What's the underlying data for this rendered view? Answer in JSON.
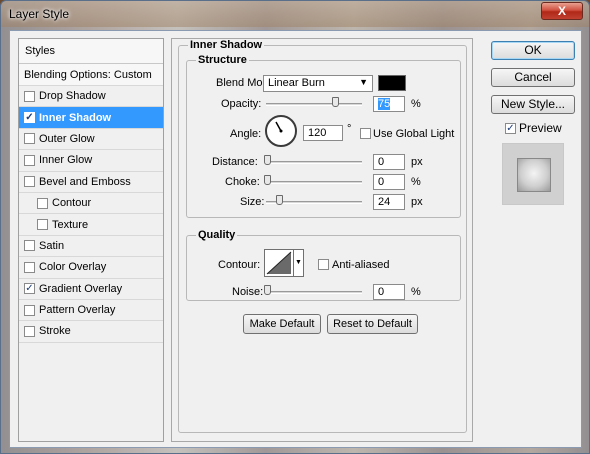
{
  "window": {
    "title": "Layer Style",
    "close_glyph": "X"
  },
  "styles": {
    "header": "Styles",
    "blending": "Blending Options: Custom",
    "items": [
      {
        "label": "Drop Shadow",
        "checked": false,
        "indent": false,
        "selected": false
      },
      {
        "label": "Inner Shadow",
        "checked": true,
        "indent": false,
        "selected": true
      },
      {
        "label": "Outer Glow",
        "checked": false,
        "indent": false,
        "selected": false
      },
      {
        "label": "Inner Glow",
        "checked": false,
        "indent": false,
        "selected": false
      },
      {
        "label": "Bevel and Emboss",
        "checked": false,
        "indent": false,
        "selected": false
      },
      {
        "label": "Contour",
        "checked": false,
        "indent": true,
        "selected": false
      },
      {
        "label": "Texture",
        "checked": false,
        "indent": true,
        "selected": false
      },
      {
        "label": "Satin",
        "checked": false,
        "indent": false,
        "selected": false
      },
      {
        "label": "Color Overlay",
        "checked": false,
        "indent": false,
        "selected": false
      },
      {
        "label": "Gradient Overlay",
        "checked": true,
        "indent": false,
        "selected": false
      },
      {
        "label": "Pattern Overlay",
        "checked": false,
        "indent": false,
        "selected": false
      },
      {
        "label": "Stroke",
        "checked": false,
        "indent": false,
        "selected": false
      }
    ]
  },
  "panel": {
    "title": "Inner Shadow",
    "structure": {
      "label": "Structure",
      "blend_mode_label": "Blend Mode:",
      "blend_mode": "Linear Burn",
      "blend_color": "#000000",
      "opacity_label": "Opacity:",
      "opacity": "75",
      "opacity_unit": "%",
      "angle_label": "Angle:",
      "angle": "120",
      "angle_unit": "°",
      "global_light_label": "Use Global Light",
      "distance_label": "Distance:",
      "distance": "0",
      "distance_unit": "px",
      "choke_label": "Choke:",
      "choke": "0",
      "choke_unit": "%",
      "size_label": "Size:",
      "size": "24",
      "size_unit": "px"
    },
    "quality": {
      "label": "Quality",
      "contour_label": "Contour:",
      "anti_aliased_label": "Anti-aliased",
      "noise_label": "Noise:",
      "noise": "0",
      "noise_unit": "%"
    },
    "make_default": "Make Default",
    "reset_default": "Reset to Default"
  },
  "actions": {
    "ok": "OK",
    "cancel": "Cancel",
    "new_style": "New Style...",
    "preview_label": "Preview",
    "preview_checked": true
  }
}
